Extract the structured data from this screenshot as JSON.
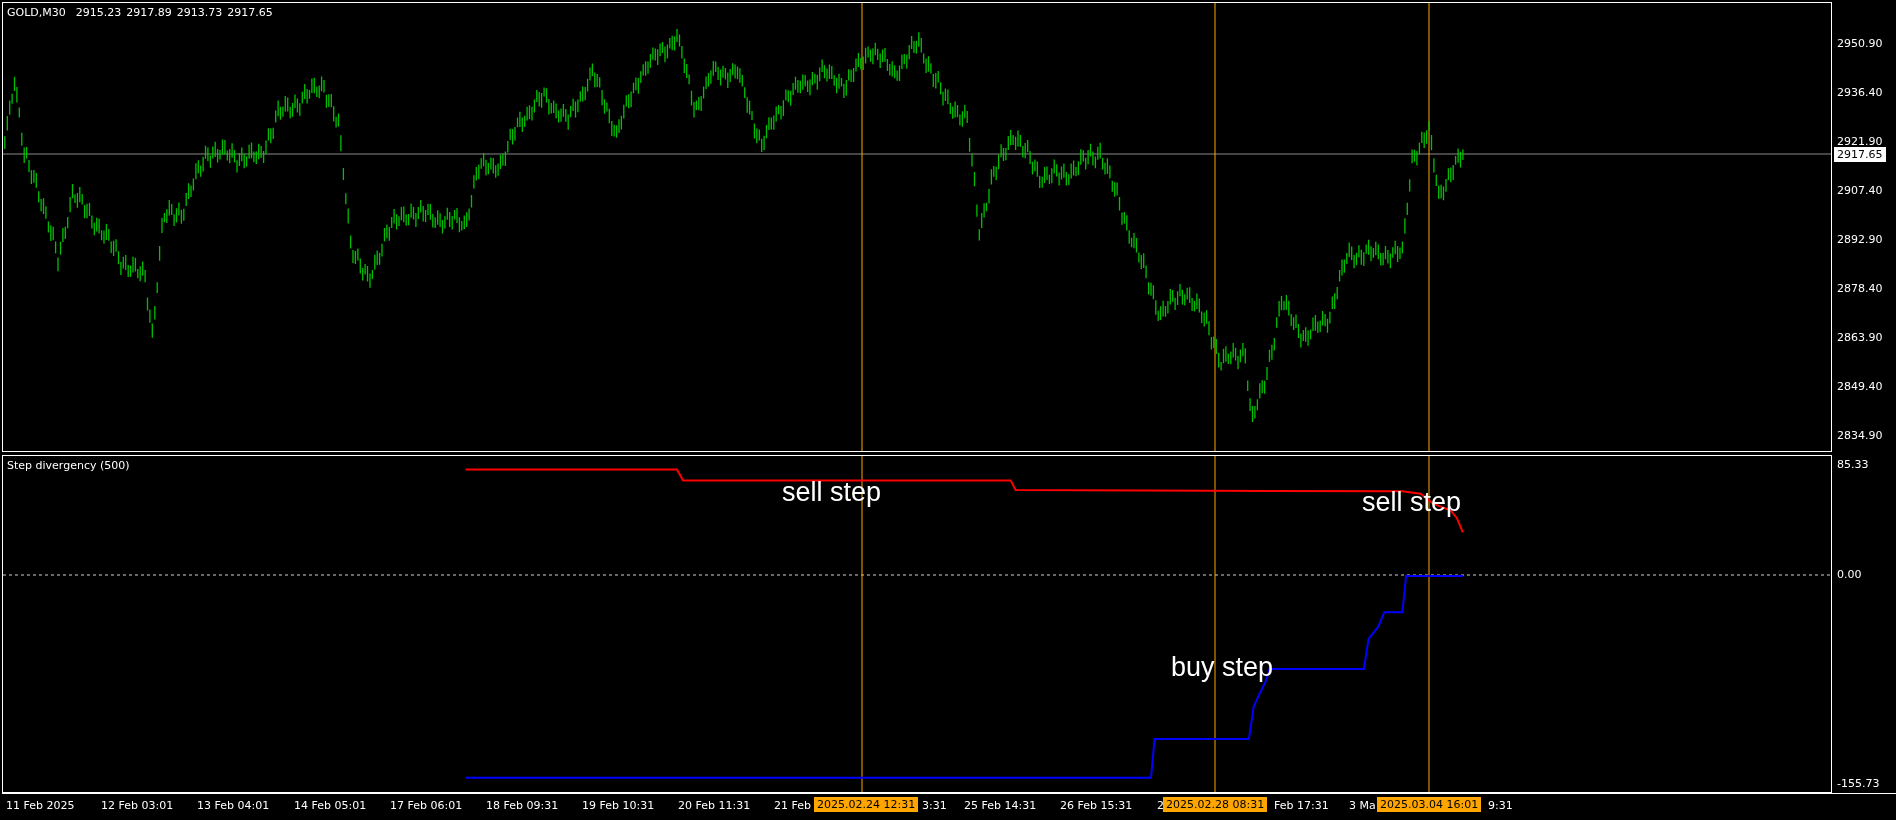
{
  "main_chart": {
    "symbol": "GOLD,M30",
    "ohlc": [
      "2915.23",
      "2917.89",
      "2913.73",
      "2917.65"
    ],
    "price_axis": [
      "2950.90",
      "2936.40",
      "2921.90",
      "2907.40",
      "2892.90",
      "2878.40",
      "2863.90",
      "2849.40",
      "2834.90"
    ],
    "current_price": "2917.65"
  },
  "indicator": {
    "title": "Step divergency (500)",
    "axis": [
      "85.33",
      "0.00",
      "-155.73"
    ],
    "annotations": [
      "sell step",
      "sell step",
      "buy step"
    ]
  },
  "time_axis": [
    {
      "kind": "date",
      "text": "11 Feb 2025"
    },
    {
      "kind": "date",
      "text": "12 Feb 03:01"
    },
    {
      "kind": "date",
      "text": "13 Feb 04:01"
    },
    {
      "kind": "date",
      "text": "14 Feb 05:01"
    },
    {
      "kind": "date",
      "text": "17 Feb 06:01"
    },
    {
      "kind": "date",
      "text": "18 Feb 09:31"
    },
    {
      "kind": "date",
      "text": "19 Feb 10:31"
    },
    {
      "kind": "date",
      "text": "20 Feb 11:31"
    },
    {
      "kind": "date",
      "text": "21 Feb"
    },
    {
      "kind": "cursor",
      "text": "2025.02.24 12:31"
    },
    {
      "kind": "date",
      "text": "3:31"
    },
    {
      "kind": "date",
      "text": "25 Feb 14:31"
    },
    {
      "kind": "date",
      "text": "26 Feb 15:31"
    },
    {
      "kind": "date",
      "text": "2"
    },
    {
      "kind": "cursor",
      "text": "2025.02.28 08:31"
    },
    {
      "kind": "date",
      "text": "Feb 17:31"
    },
    {
      "kind": "date",
      "text": "3 Ma"
    },
    {
      "kind": "cursor",
      "text": "2025.03.04 16:01"
    },
    {
      "kind": "date",
      "text": "9:31"
    }
  ]
}
